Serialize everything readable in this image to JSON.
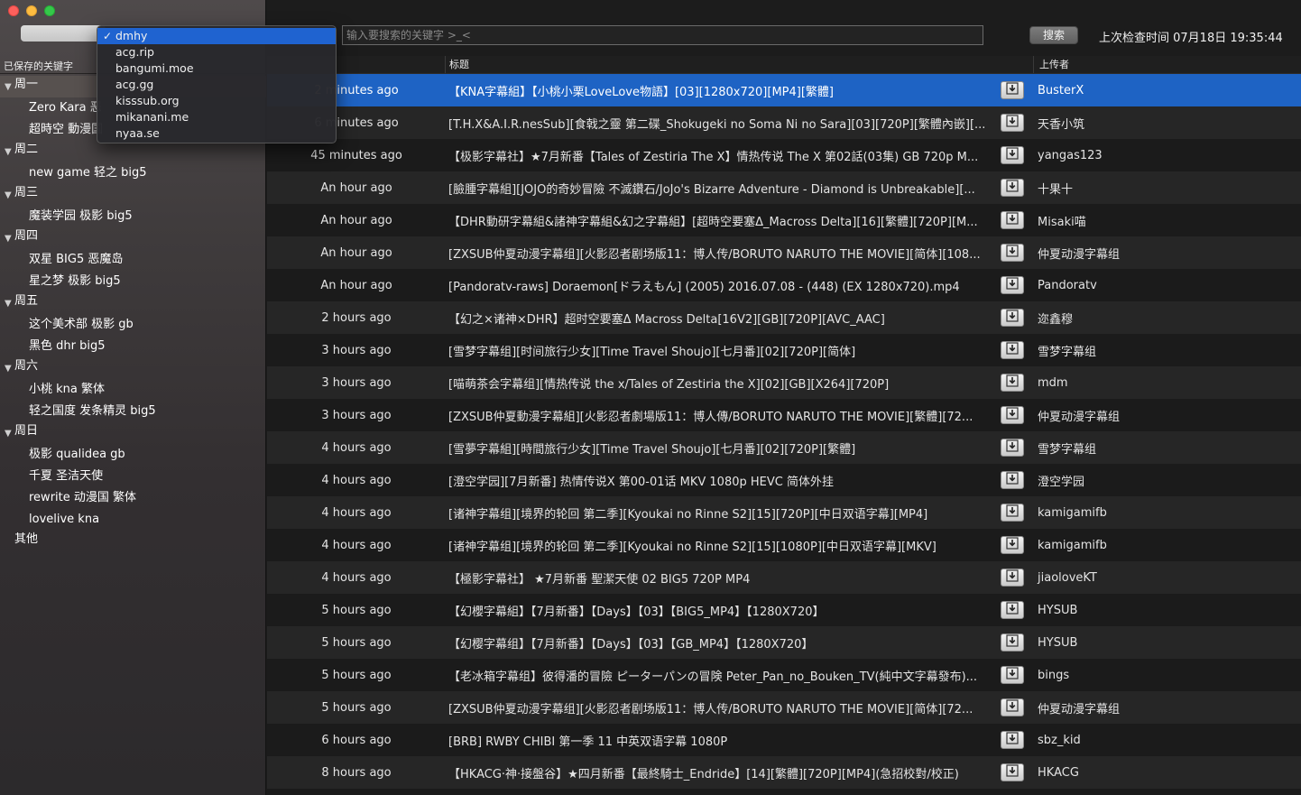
{
  "source_menu": {
    "selected": "dmhy",
    "options": [
      "dmhy",
      "acg.rip",
      "bangumi.moe",
      "acg.gg",
      "kisssub.org",
      "mikanani.me",
      "nyaa.se"
    ]
  },
  "sidebar": {
    "header": "已保存的关键字",
    "groups": [
      {
        "label": "周一",
        "items": [
          "Zero Kara 恶",
          "超時空 動漫国"
        ]
      },
      {
        "label": "周二",
        "items": [
          "new game 轻之 big5"
        ]
      },
      {
        "label": "周三",
        "items": [
          "魔装学园 极影 big5"
        ]
      },
      {
        "label": "周四",
        "items": [
          "双星 BIG5 恶魔岛",
          "星之梦 极影 big5"
        ]
      },
      {
        "label": "周五",
        "items": [
          "这个美术部 极影 gb",
          "黑色 dhr big5"
        ]
      },
      {
        "label": "周六",
        "items": [
          "小桃 kna 繁体",
          "轻之国度 发条精灵 big5"
        ]
      },
      {
        "label": "周日",
        "items": [
          "极影 qualidea gb",
          "千夏 圣洁天使",
          "rewrite 动漫国 繁体",
          "lovelive kna"
        ]
      }
    ],
    "other_label": "其他"
  },
  "toolbar": {
    "search_placeholder": "输入要搜索的关键字 >_<",
    "search_button": "搜索",
    "last_check": "上次检查时间 07月18日 19:35:44"
  },
  "table": {
    "headers": {
      "title": "标题",
      "uploader": "上传者"
    },
    "rows": [
      {
        "time": "2 minutes ago",
        "title": "【KNA字幕組】【小桃小栗LoveLove物語】[03][1280x720][MP4][繁體]",
        "uploader": "BusterX"
      },
      {
        "time": "6 minutes ago",
        "title": "[T.H.X&A.I.R.nesSub][食戟之靈 第二碟_Shokugeki no Soma Ni no Sara][03][720P][繁體內嵌][...",
        "uploader": "天香小筑"
      },
      {
        "time": "45 minutes ago",
        "title": "【极影字幕社】★7月新番【Tales of Zestiria The X】情热传说 The X 第02話(03集) GB 720p M...",
        "uploader": "yangas123"
      },
      {
        "time": "An hour ago",
        "title": "[臉腫字幕組][JOJO的奇妙冒險 不滅鑽石/JoJo's Bizarre Adventure - Diamond is Unbreakable][...",
        "uploader": "十果十"
      },
      {
        "time": "An hour ago",
        "title": "【DHR動研字幕組&諸神字幕組&幻之字幕組】[超時空要塞Δ_Macross Delta][16][繁體][720P][M...",
        "uploader": "Misaki喵"
      },
      {
        "time": "An hour ago",
        "title": "[ZXSUB仲夏动漫字幕组][火影忍者剧场版11：博人传/BORUTO NARUTO THE MOVIE][简体][108...",
        "uploader": "仲夏动漫字幕组"
      },
      {
        "time": "An hour ago",
        "title": "[Pandoratv-raws] Doraemon[ドラえもん] (2005) 2016.07.08 - (448) (EX 1280x720).mp4",
        "uploader": "Pandoratv"
      },
      {
        "time": "2 hours ago",
        "title": "【幻之×诸神×DHR】超时空要塞Δ Macross Delta[16V2][GB][720P][AVC_AAC]",
        "uploader": "迩鑫穆"
      },
      {
        "time": "3 hours ago",
        "title": "[雪梦字幕组][时间旅行少女][Time Travel Shoujo][七月番][02][720P][简体]",
        "uploader": "雪梦字幕组"
      },
      {
        "time": "3 hours ago",
        "title": "[喵萌茶会字幕组][情热传说 the x/Tales of Zestiria the X][02][GB][X264][720P]",
        "uploader": "mdm"
      },
      {
        "time": "3 hours ago",
        "title": "[ZXSUB仲夏動漫字幕組][火影忍者劇場版11：博人傳/BORUTO NARUTO THE MOVIE][繁體][72...",
        "uploader": "仲夏动漫字幕组"
      },
      {
        "time": "4 hours ago",
        "title": "[雪夢字幕組][時間旅行少女][Time Travel Shoujo][七月番][02][720P][繁體]",
        "uploader": "雪梦字幕组"
      },
      {
        "time": "4 hours ago",
        "title": "[澄空学园][7月新番] 热情传说X 第00-01话 MKV 1080p HEVC 简体外挂",
        "uploader": "澄空学园"
      },
      {
        "time": "4 hours ago",
        "title": "[诸神字幕组][境界的轮回 第二季][Kyoukai no Rinne S2][15][720P][中日双语字幕][MP4]",
        "uploader": "kamigamifb"
      },
      {
        "time": "4 hours ago",
        "title": "[诸神字幕组][境界的轮回 第二季][Kyoukai no Rinne S2][15][1080P][中日双语字幕][MKV]",
        "uploader": "kamigamifb"
      },
      {
        "time": "4 hours ago",
        "title": "【極影字幕社】 ★7月新番 聖潔天使 02 BIG5 720P MP4",
        "uploader": "jiaoloveKT"
      },
      {
        "time": "5 hours ago",
        "title": "【幻櫻字幕組】【7月新番】【Days】【03】【BIG5_MP4】【1280X720】",
        "uploader": "HYSUB"
      },
      {
        "time": "5 hours ago",
        "title": "【幻樱字幕组】【7月新番】【Days】【03】【GB_MP4】【1280X720】",
        "uploader": "HYSUB"
      },
      {
        "time": "5 hours ago",
        "title": "【老冰箱字幕组】彼得潘的冒險 ピーターパンの冒険 Peter_Pan_no_Bouken_TV(純中文字幕發布)...",
        "uploader": "bings"
      },
      {
        "time": "5 hours ago",
        "title": "[ZXSUB仲夏动漫字幕组][火影忍者剧场版11：博人传/BORUTO NARUTO THE MOVIE][简体][72...",
        "uploader": "仲夏动漫字幕组"
      },
      {
        "time": "6 hours ago",
        "title": "[BRB] RWBY CHIBI 第一季 11 中英双语字幕 1080P",
        "uploader": "sbz_kid"
      },
      {
        "time": "8 hours ago",
        "title": "【HKACG·神·接盤谷】★四月新番【最終騎士_Endride】[14][繁體][720P][MP4](急招校對/校正)",
        "uploader": "HKACG"
      }
    ]
  },
  "colors": {
    "selection": "#1e63c4",
    "sidebar_top": "#4f4a4b"
  },
  "icons": {
    "download": "download-arrow-icon",
    "checkmark": "checkmark-icon",
    "disclosure": "disclosure-triangle-icon"
  }
}
